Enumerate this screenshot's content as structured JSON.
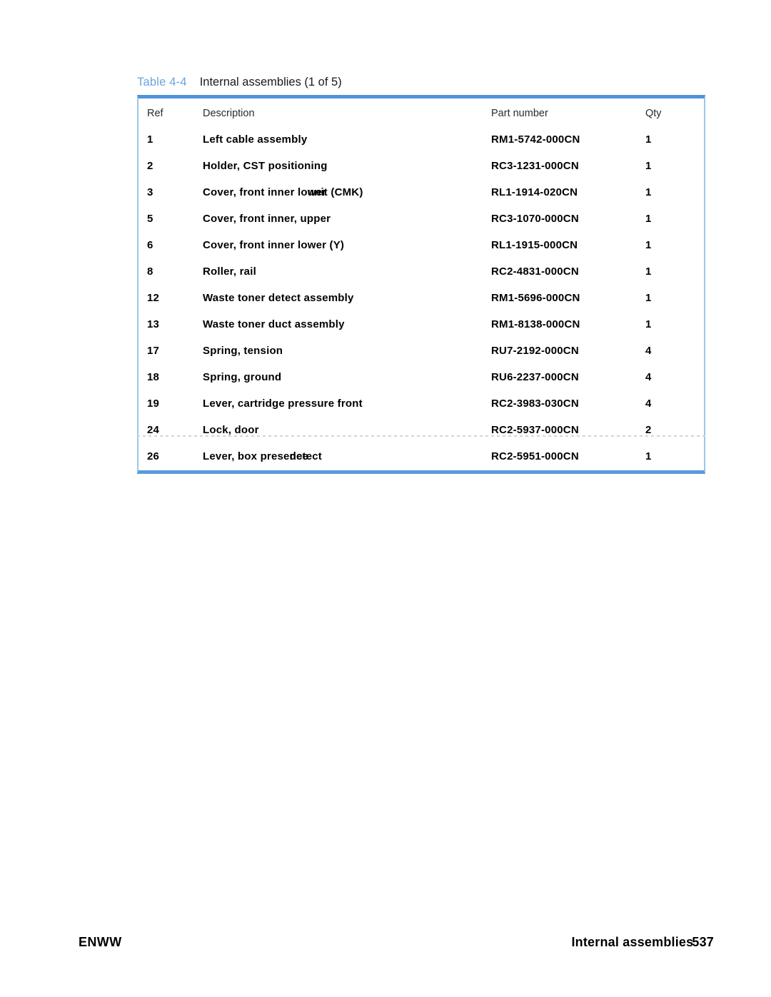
{
  "document": {
    "caption": {
      "label": "Table 4-4",
      "text": "Internal assemblies (1 of 5)"
    },
    "colors": {
      "caption_label": "#6BA4DC",
      "table_border_top": "#4F93D8",
      "table_border_bottom": "#5A9BDC",
      "table_border_side": "#9EC6E8",
      "body_text": "#000000"
    }
  },
  "table": {
    "headers": {
      "ref": "Ref",
      "description": "Description",
      "part_number": "Part number",
      "qty": "Qty"
    },
    "rows": [
      {
        "ref": "1",
        "description": "Left cable assembly",
        "description_overlap": null,
        "part_number": "RM1-5742-000CN",
        "qty": "1"
      },
      {
        "ref": "2",
        "description": "Holder, CST positioning",
        "description_overlap": null,
        "part_number": "RC3-1231-000CN",
        "qty": "1"
      },
      {
        "ref": "3",
        "description": "Cover, front inner lower unit (CMK)",
        "description_overlap": {
          "prefix": "Cover, front inner lo",
          "word_a": "wer",
          "word_b": "unit",
          "suffix": " (CMK)"
        },
        "part_number": "RL1-1914-020CN",
        "qty": "1"
      },
      {
        "ref": "5",
        "description": "Cover, front inner, upper",
        "description_overlap": null,
        "part_number": "RC3-1070-000CN",
        "qty": "1"
      },
      {
        "ref": "6",
        "description": "Cover, front inner lower (Y)",
        "description_overlap": null,
        "part_number": "RL1-1915-000CN",
        "qty": "1"
      },
      {
        "ref": "8",
        "description": "Roller, rail",
        "description_overlap": null,
        "part_number": "RC2-4831-000CN",
        "qty": "1"
      },
      {
        "ref": "12",
        "description": "Waste toner detect assembly",
        "description_overlap": null,
        "part_number": "RM1-5696-000CN",
        "qty": "1"
      },
      {
        "ref": "13",
        "description": "Waste toner duct assembly",
        "description_overlap": null,
        "part_number": "RM1-8138-000CN",
        "qty": "1"
      },
      {
        "ref": "17",
        "description": "Spring, tension",
        "description_overlap": null,
        "part_number": "RU7-2192-000CN",
        "qty": "4"
      },
      {
        "ref": "18",
        "description": "Spring, ground",
        "description_overlap": null,
        "part_number": "RU6-2237-000CN",
        "qty": "4"
      },
      {
        "ref": "19",
        "description": "Lever, cartridge pressure front",
        "description_overlap": null,
        "part_number": "RC2-3983-030CN",
        "qty": "4"
      },
      {
        "ref": "24",
        "description": "Lock, door",
        "description_overlap": null,
        "part_number": "RC2-5937-000CN",
        "qty": "2"
      },
      {
        "ref": "26",
        "description": "Lever, box presence detect",
        "description_overlap": {
          "prefix": "Lever, box prese",
          "word_a": "nce",
          "word_b": "detect",
          "suffix": ""
        },
        "part_number": "RC2-5951-000CN",
        "qty": "1"
      }
    ]
  },
  "footer": {
    "left": "ENWW",
    "right_label": "Internal assemblies",
    "page_number": "537"
  }
}
